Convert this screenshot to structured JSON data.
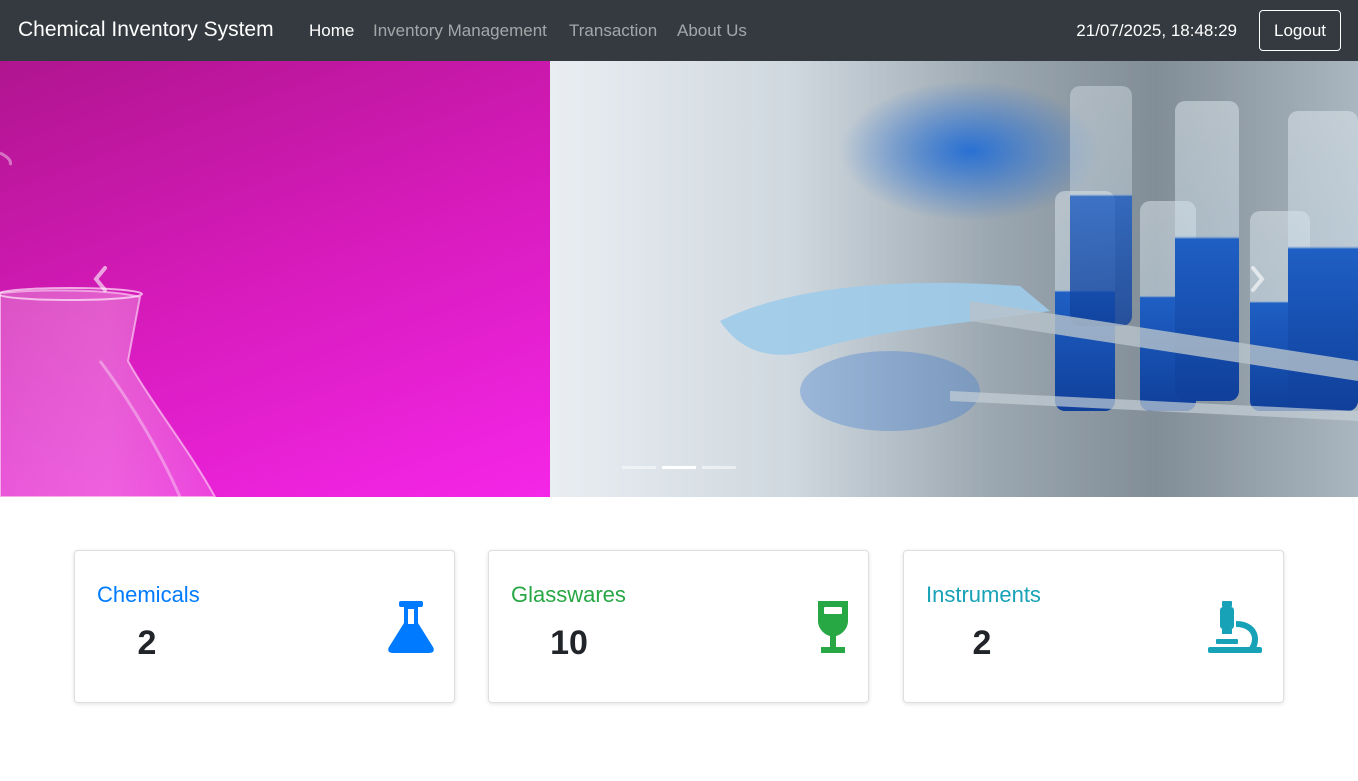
{
  "app": {
    "title": "Chemical Inventory System",
    "datetime": "21/07/2025, 18:48:29",
    "logout_label": "Logout"
  },
  "nav": {
    "items": [
      {
        "label": "Home",
        "active": true
      },
      {
        "label": "Inventory Management",
        "active": false
      },
      {
        "label": "Transaction",
        "active": false
      },
      {
        "label": "About Us",
        "active": false
      }
    ]
  },
  "carousel": {
    "slide_count": 3,
    "active_index": 1,
    "prev_icon": "chevron-left-icon",
    "next_icon": "chevron-right-icon"
  },
  "stats": [
    {
      "label": "Chemicals",
      "count": "2",
      "icon": "flask-icon",
      "color": "#007bff"
    },
    {
      "label": "Glasswares",
      "count": "10",
      "icon": "wine-glass-icon",
      "color": "#28a745"
    },
    {
      "label": "Instruments",
      "count": "2",
      "icon": "microscope-icon",
      "color": "#17a2b8"
    }
  ],
  "colors": {
    "navbar_bg": "#343a40",
    "primary": "#007bff",
    "success": "#28a745",
    "info": "#17a2b8"
  }
}
